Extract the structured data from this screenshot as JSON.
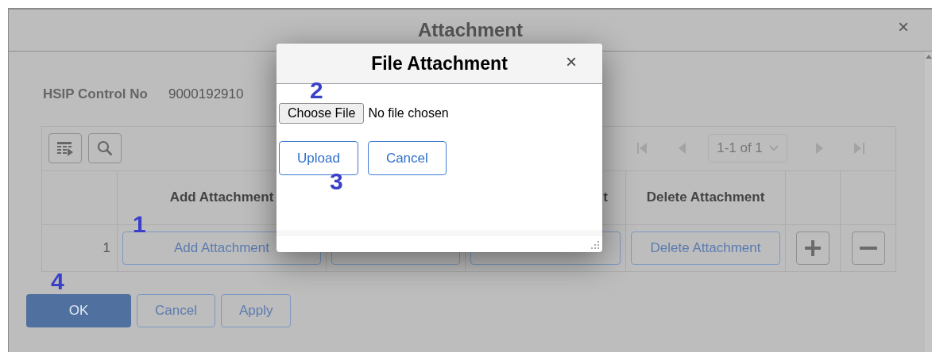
{
  "dialog": {
    "title": "Attachment",
    "close": "×"
  },
  "control_no": {
    "label": "HSIP Control No",
    "value": "9000192910"
  },
  "grid": {
    "pagination": "1-1 of 1",
    "columns": [
      {
        "kind": "blank"
      },
      {
        "kind": "text",
        "label": "Add Attachment"
      },
      {
        "kind": "blank"
      },
      {
        "kind": "tail",
        "label": "t"
      },
      {
        "kind": "text",
        "label": "Delete Attachment"
      },
      {
        "kind": "blank"
      },
      {
        "kind": "blank"
      }
    ],
    "row": [
      {
        "kind": "number",
        "text": "1"
      },
      {
        "kind": "button",
        "label": "Add Attachment"
      },
      {
        "kind": "button"
      },
      {
        "kind": "button"
      },
      {
        "kind": "button",
        "label": "Delete Attachment"
      },
      {
        "kind": "plus"
      },
      {
        "kind": "minus"
      }
    ]
  },
  "footer_buttons": [
    {
      "label": "OK",
      "primary": true
    },
    {
      "label": "Cancel",
      "primary": false
    },
    {
      "label": "Apply",
      "primary": false
    }
  ],
  "modal": {
    "title": "File Attachment",
    "close": "×",
    "file_button": "Choose File",
    "file_status": "No file chosen",
    "buttons": [
      {
        "label": "Upload"
      },
      {
        "label": "Cancel"
      }
    ]
  },
  "annotations": [
    {
      "text": "1"
    },
    {
      "text": "2"
    },
    {
      "text": "3"
    },
    {
      "text": "4"
    }
  ]
}
